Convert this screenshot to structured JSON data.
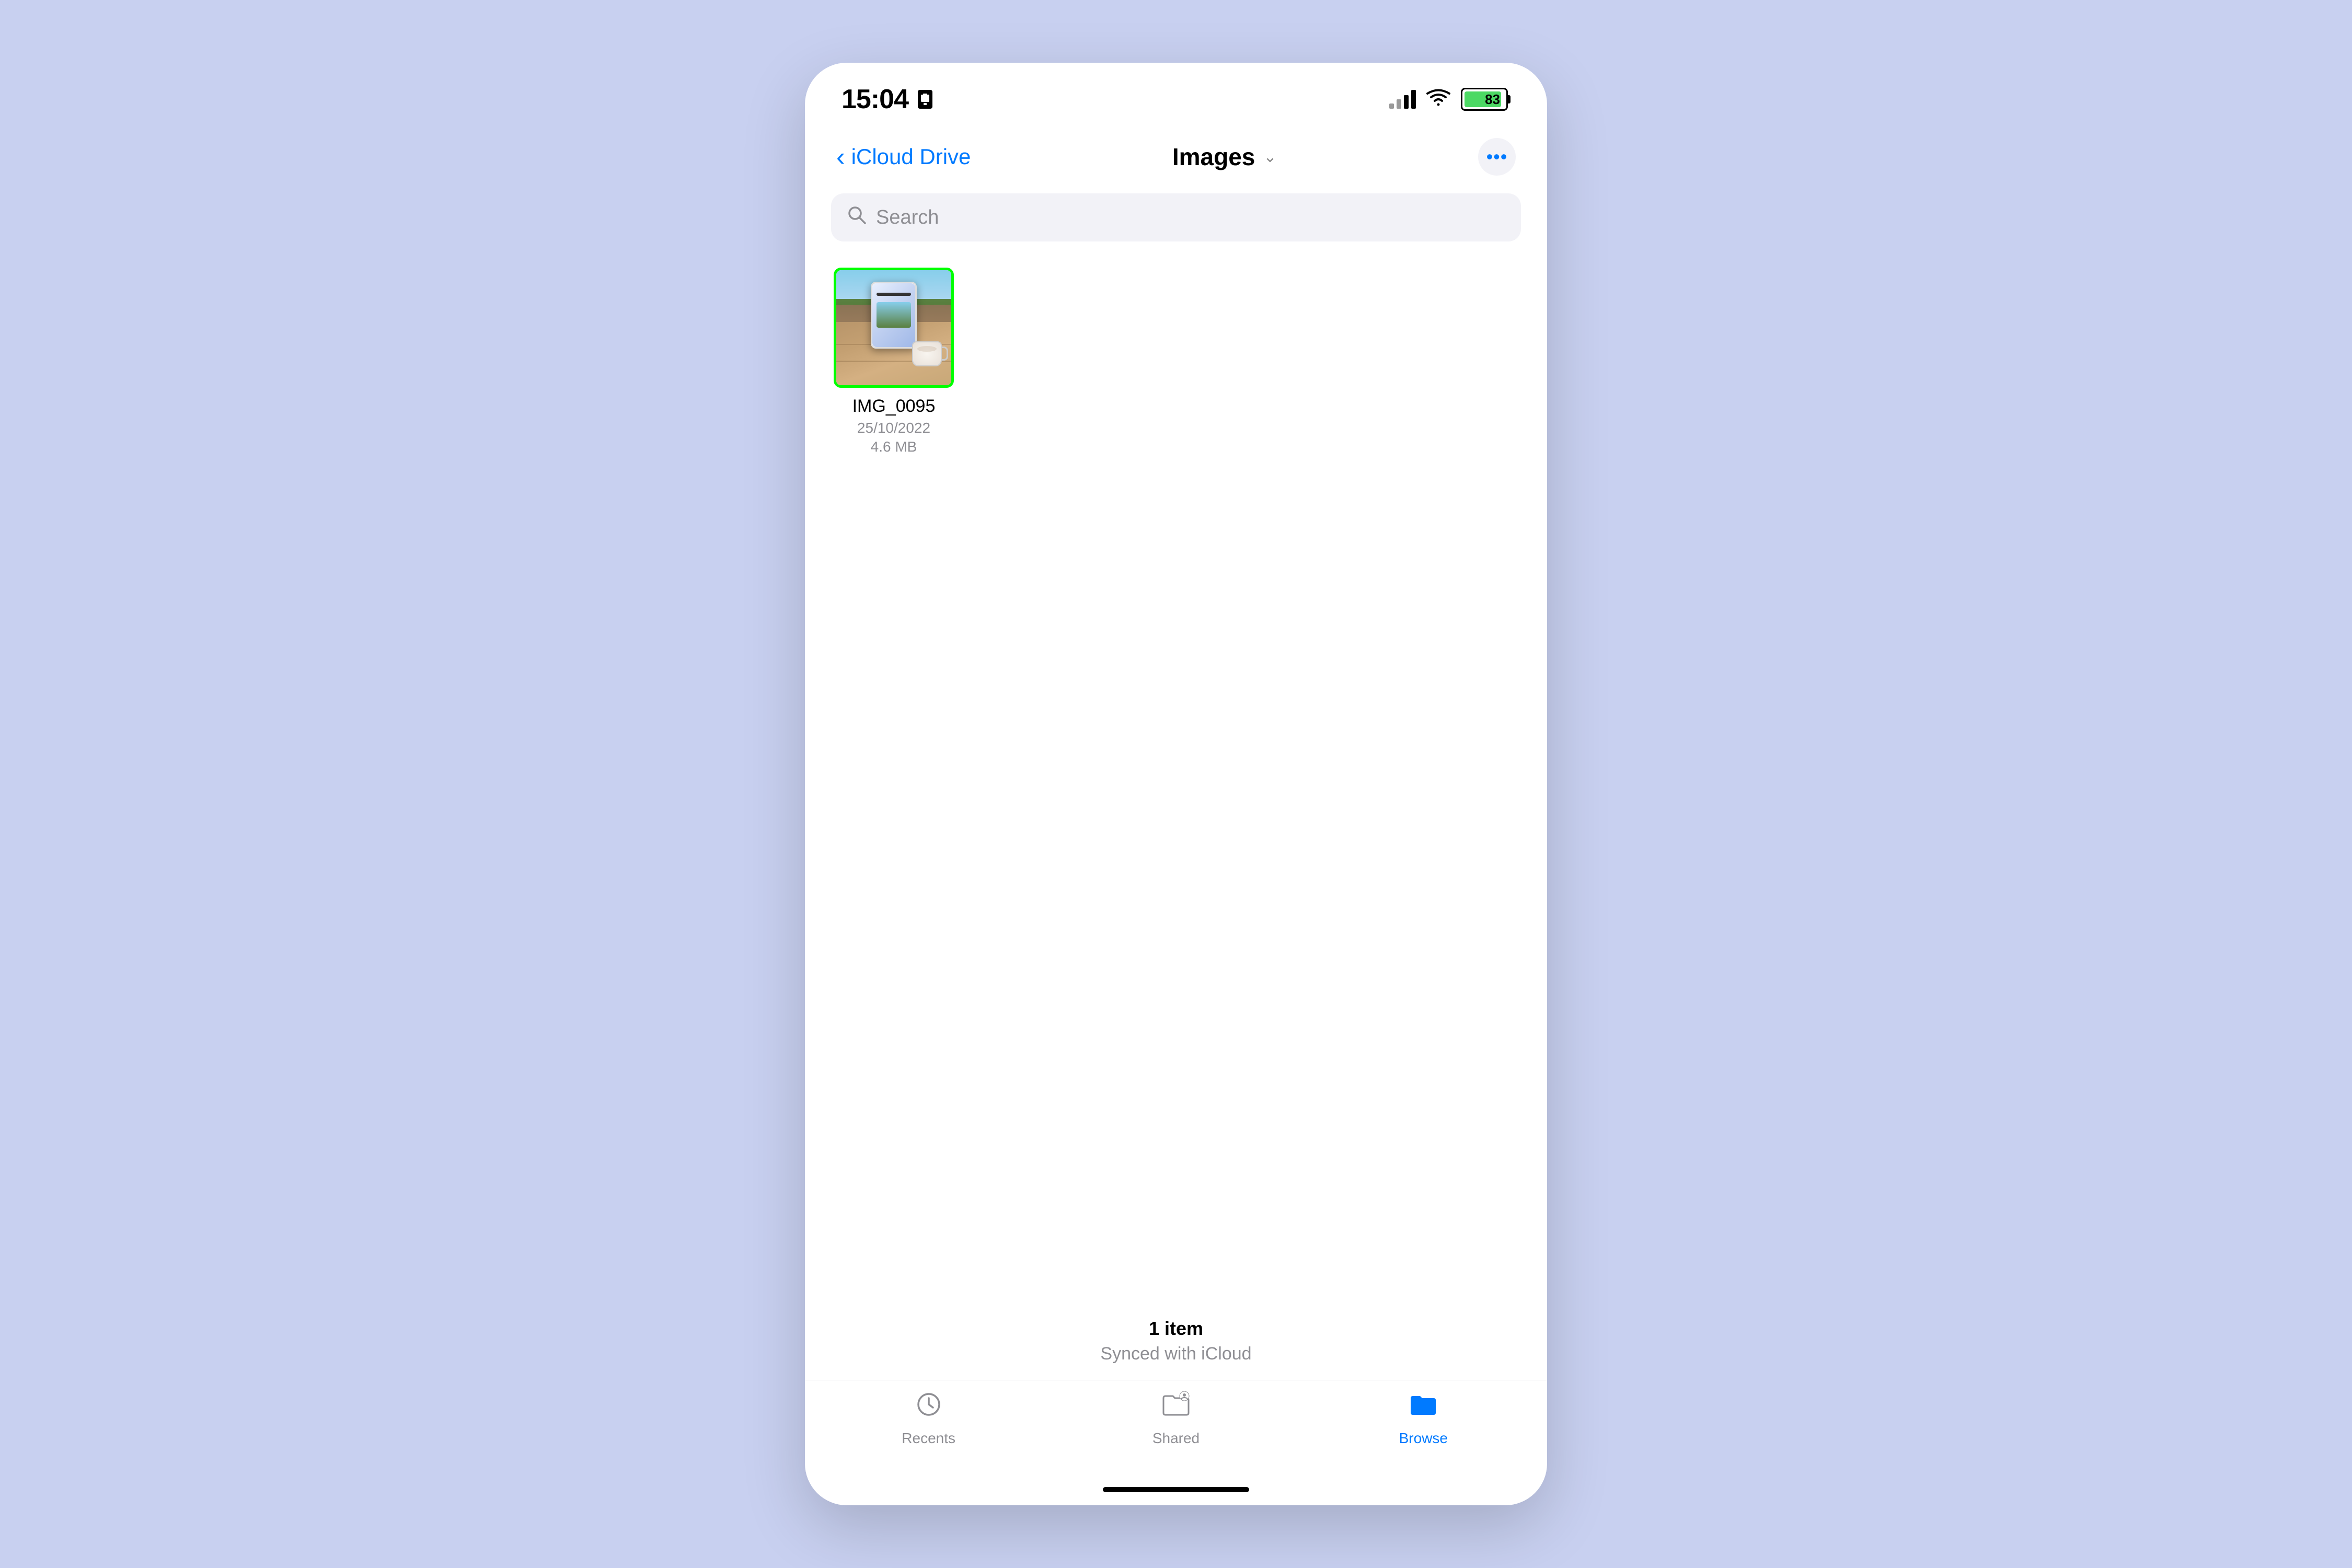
{
  "statusBar": {
    "time": "15:04",
    "batteryLevel": "83"
  },
  "navigation": {
    "backLabel": "iCloud Drive",
    "title": "Images",
    "moreButtonLabel": "•••"
  },
  "search": {
    "placeholder": "Search"
  },
  "files": [
    {
      "name": "IMG_0095",
      "date": "25/10/2022",
      "size": "4.6 MB"
    }
  ],
  "footer": {
    "itemCount": "1 item",
    "syncStatus": "Synced with iCloud"
  },
  "tabBar": {
    "tabs": [
      {
        "id": "recents",
        "label": "Recents",
        "active": false
      },
      {
        "id": "shared",
        "label": "Shared",
        "active": false
      },
      {
        "id": "browse",
        "label": "Browse",
        "active": true
      }
    ]
  },
  "colors": {
    "accent": "#007aff",
    "selectedBorder": "#00ff00",
    "inactive": "#8e8e93"
  }
}
